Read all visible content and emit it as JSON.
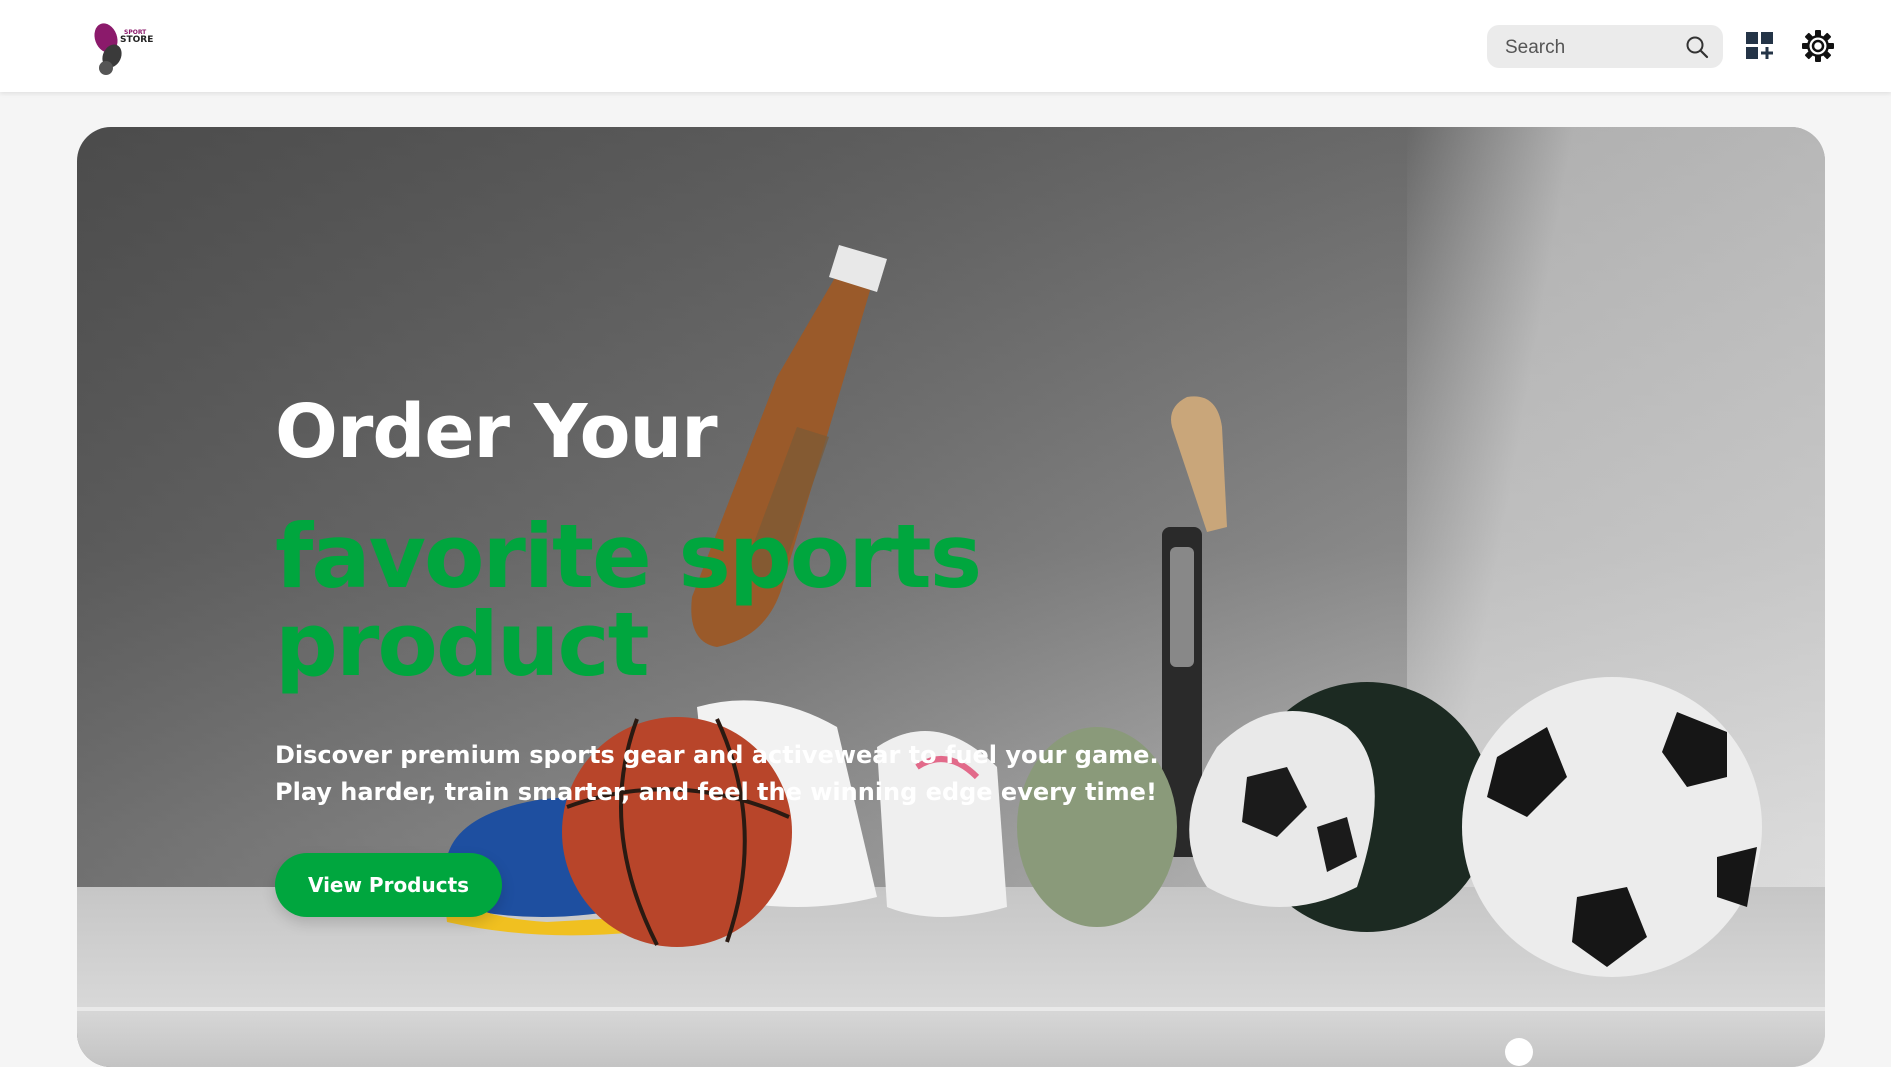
{
  "header": {
    "logo": {
      "line1": "SPORT",
      "line2": "STORE"
    },
    "search": {
      "placeholder": "Search",
      "value": ""
    }
  },
  "hero": {
    "title_line1": "Order Your",
    "title_line2": "favorite sports product",
    "description_line1": "Discover premium sports gear and activewear to fuel your game.",
    "description_line2": "Play harder, train smarter, and feel the winning edge every time!",
    "cta_label": "View Products"
  },
  "colors": {
    "accent_green": "#00a63e",
    "logo_magenta": "#8b1a6b",
    "icon_dark": "#243447"
  },
  "icons": [
    "search-icon",
    "grid-plus-icon",
    "gear-icon"
  ]
}
